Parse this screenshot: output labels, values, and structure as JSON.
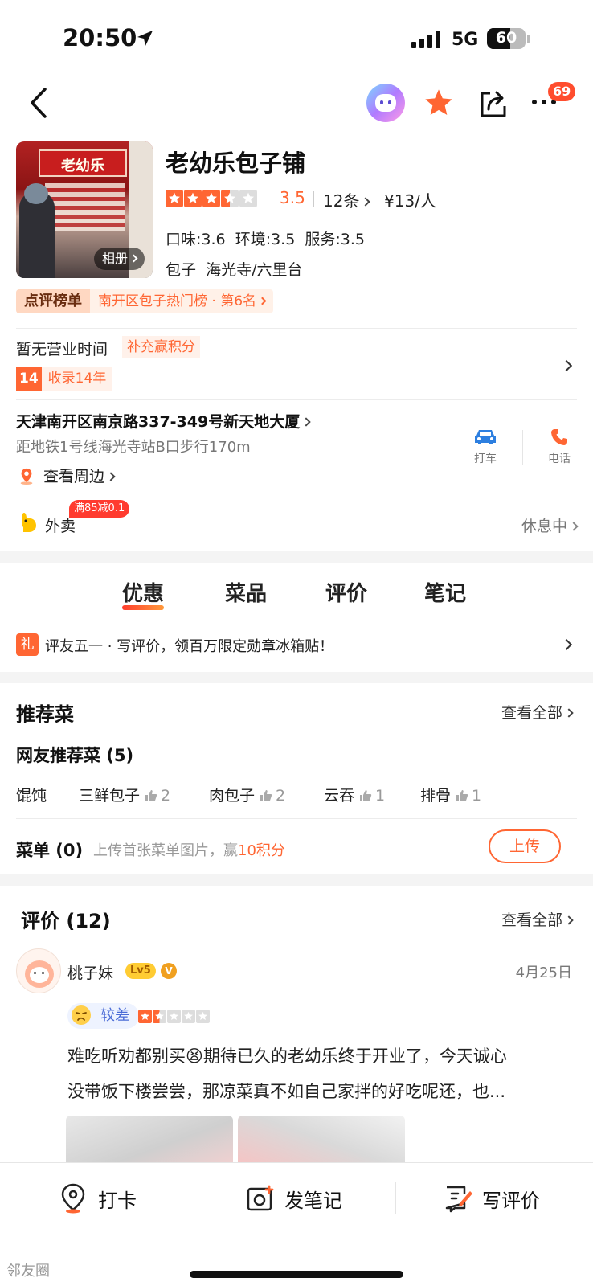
{
  "status_bar": {
    "time": "20:50",
    "network": "5G",
    "battery": "60"
  },
  "nav": {
    "badge": "69"
  },
  "shop": {
    "name": "老幼乐包子铺",
    "rating": "3.5",
    "reviews_link": "12条",
    "price": "¥13/人",
    "scores": "口味:3.6  环境:3.5  服务:3.5",
    "tags": "包子  海光寺/六里台",
    "album_label": "相册",
    "ranking_tag": "点评榜单",
    "ranking_text": "南开区包子热门榜 · 第6名",
    "storefront_text": "老幼乐"
  },
  "hours": {
    "text": "暂无营业时间",
    "supplement": "补充赢积分",
    "years_num": "14",
    "years_text": "收录14年"
  },
  "address": {
    "text": "天津南开区南京路337-349号新天地大厦",
    "distance": "距地铁1号线海光寺站B口步行170m",
    "nearby": "查看周边",
    "taxi": "打车",
    "phone": "电话"
  },
  "delivery": {
    "label": "外卖",
    "promo": "满85减0.1",
    "status": "休息中"
  },
  "tabs": [
    "优惠",
    "菜品",
    "评价",
    "笔记"
  ],
  "promo": {
    "icon": "礼",
    "text": "评友五一 · 写评价，领百万限定勋章冰箱贴！"
  },
  "recommend": {
    "title": "推荐菜",
    "see_all": "查看全部",
    "subtitle": "网友推荐菜 (5)",
    "dishes": [
      {
        "name": "馄饨",
        "likes": ""
      },
      {
        "name": "三鲜包子",
        "likes": "2"
      },
      {
        "name": "肉包子",
        "likes": "2"
      },
      {
        "name": "云吞",
        "likes": "1"
      },
      {
        "name": "排骨",
        "likes": "1"
      }
    ],
    "menu_label": "菜单 (0)",
    "menu_hint": "上传首张菜单图片，赢",
    "menu_points": "10积分",
    "upload": "上传"
  },
  "reviews": {
    "title": "评价 (12)",
    "see_all": "查看全部",
    "user": "桃子妹",
    "level": "Lv5",
    "date": "4月25日",
    "mood": "较差",
    "stars": 1.5,
    "text1": "难吃听劝都别买😫期待已久的老幼乐终于开业了，今天诚心",
    "text2": "没带饭下楼尝尝，那凉菜真不如自己家拌的好吃呢还，也..."
  },
  "bottom": {
    "checkin": "打卡",
    "note": "发笔记",
    "review": "写评价"
  },
  "watermark": "邻友圈",
  "colors": {
    "accent": "#ff6633",
    "star": "#ff6633",
    "promo_red": "#ff4d2e"
  }
}
